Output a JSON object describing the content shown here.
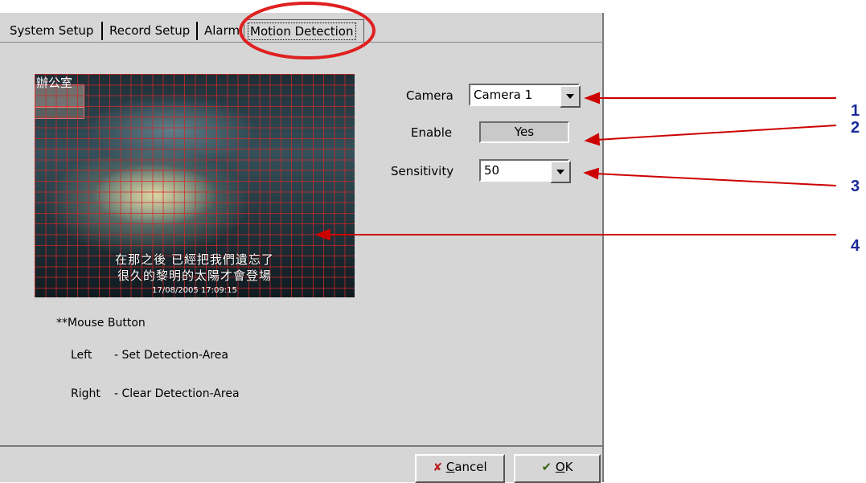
{
  "tabs": [
    {
      "label": "System Setup"
    },
    {
      "label": "Record Setup"
    },
    {
      "label": "Alarm"
    },
    {
      "label": "Motion Detection"
    }
  ],
  "form": {
    "camera_label": "Camera",
    "camera_value": "Camera 1",
    "enable_label": "Enable",
    "enable_value": "Yes",
    "sensitivity_label": "Sensitivity",
    "sensitivity_value": "50"
  },
  "preview": {
    "title": "辦公室",
    "subtitle_line1": "在那之後 已經把我們遺忘了",
    "subtitle_line2": "很久的黎明的太陽才會登場",
    "timestamp": "17/08/2005 17:09:15"
  },
  "help": {
    "heading": "**Mouse Button",
    "left_key": "Left",
    "left_desc": "- Set Detection-Area",
    "right_key": "Right",
    "right_desc": "- Clear Detection-Area"
  },
  "buttons": {
    "cancel_prefix": "",
    "cancel_mnemonic": "C",
    "cancel_rest": "ancel",
    "ok_mnemonic": "O",
    "ok_rest": "K"
  },
  "callouts": [
    "1",
    "2",
    "3",
    "4"
  ],
  "colors": {
    "callout_arrow": "#cc0000",
    "callout_number": "#1a2a9a",
    "highlight_circle": "#e02020"
  }
}
